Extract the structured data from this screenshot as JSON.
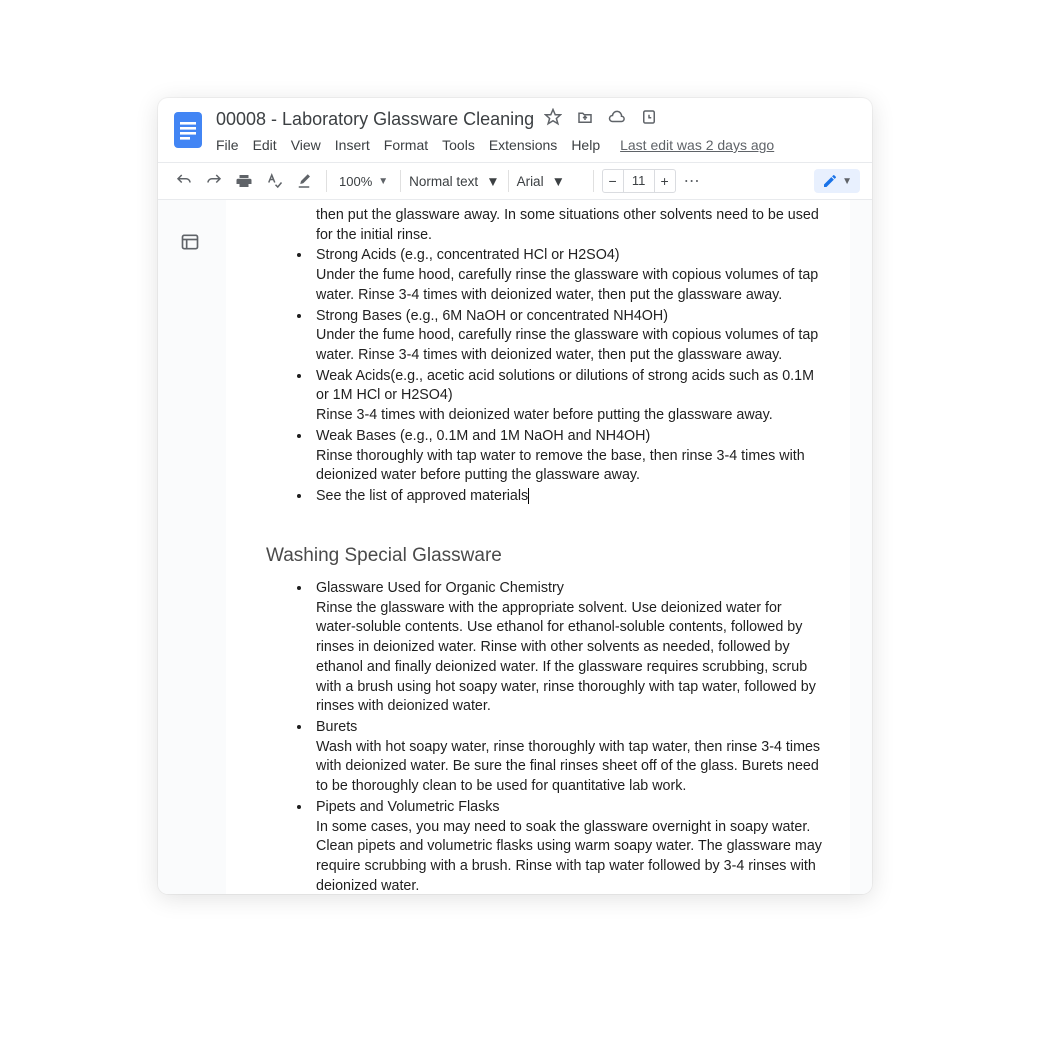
{
  "header": {
    "title": "00008 - Laboratory Glassware Cleaning",
    "last_edit": "Last edit was 2 days ago"
  },
  "menu": {
    "file": "File",
    "edit": "Edit",
    "view": "View",
    "insert": "Insert",
    "format": "Format",
    "tools": "Tools",
    "extensions": "Extensions",
    "help": "Help"
  },
  "toolbar": {
    "zoom": "100%",
    "style": "Normal text",
    "font": "Arial",
    "font_size": "11",
    "minus": "−",
    "plus": "+",
    "more": "⋯"
  },
  "doc": {
    "continued_para": "then put the glassware away. In some situations other solvents need to be used for the initial rinse.",
    "list1": [
      {
        "title": "Strong Acids (e.g., concentrated HCl or H2SO4)",
        "body": "Under the fume hood, carefully rinse the glassware with copious volumes of tap water. Rinse 3-4 times with deionized water, then put the glassware away."
      },
      {
        "title": "Strong Bases (e.g., 6M NaOH or concentrated NH4OH)",
        "body": "Under the fume hood, carefully rinse the glassware with copious volumes of tap water. Rinse 3-4 times with deionized water, then put the glassware away."
      },
      {
        "title": "Weak Acids(e.g., acetic acid solutions or dilutions of strong acids such as 0.1M or 1M HCl or H2SO4)",
        "body": "Rinse 3-4 times with deionized water before putting the glassware away."
      },
      {
        "title": "Weak Bases (e.g., 0.1M and 1M NaOH and NH4OH)",
        "body": "Rinse thoroughly with tap water to remove the base, then rinse 3-4 times with deionized water before putting the glassware away."
      },
      {
        "title": "See the list of approved materials",
        "body": ""
      }
    ],
    "heading": "Washing Special Glassware",
    "list2": [
      {
        "title": "Glassware Used for Organic Chemistry",
        "body": "Rinse the glassware with the appropriate solvent. Use deionized water for water-soluble contents. Use ethanol for ethanol-soluble contents, followed by rinses in deionized water. Rinse with other solvents as needed, followed by ethanol and finally deionized water. If the glassware requires scrubbing, scrub with a brush using hot soapy water, rinse thoroughly with tap water, followed by rinses with deionized water."
      },
      {
        "title": "Burets",
        "body": "Wash with hot soapy water, rinse thoroughly with tap water, then rinse 3-4 times with deionized water. Be sure the final rinses sheet off of the glass. Burets need to be thoroughly clean to be used for quantitative lab work."
      },
      {
        "title": "Pipets and Volumetric Flasks",
        "body": "In some cases, you may need to soak the glassware overnight in soapy water. Clean pipets and volumetric flasks using warm soapy water. The glassware may require scrubbing with a brush. Rinse with tap water followed by 3-4 rinses with deionized water."
      }
    ]
  }
}
